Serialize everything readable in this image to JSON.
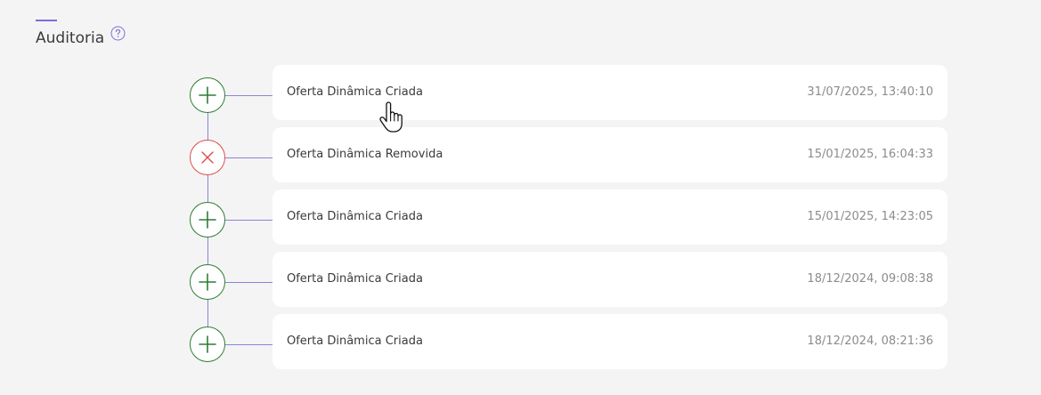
{
  "header": {
    "title": "Auditoria",
    "help_icon": "question-circle-icon",
    "accent_color": "#7a6fd6"
  },
  "colors": {
    "add": "#2e7d32",
    "remove": "#e14b4b",
    "connector": "#8a84d8"
  },
  "events": [
    {
      "label": "Oferta Dinâmica Criada",
      "timestamp": "31/07/2025, 13:40:10",
      "type": "add",
      "icon": "plus-icon"
    },
    {
      "label": "Oferta Dinâmica Removida",
      "timestamp": "15/01/2025, 16:04:33",
      "type": "remove",
      "icon": "close-icon"
    },
    {
      "label": "Oferta Dinâmica Criada",
      "timestamp": "15/01/2025, 14:23:05",
      "type": "add",
      "icon": "plus-icon"
    },
    {
      "label": "Oferta Dinâmica Criada",
      "timestamp": "18/12/2024, 09:08:38",
      "type": "add",
      "icon": "plus-icon"
    },
    {
      "label": "Oferta Dinâmica Criada",
      "timestamp": "18/12/2024, 08:21:36",
      "type": "add",
      "icon": "plus-icon"
    }
  ]
}
